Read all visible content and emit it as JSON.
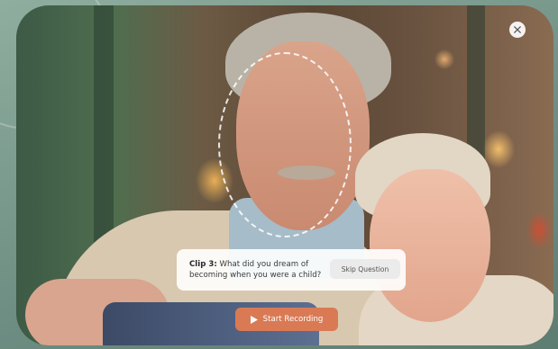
{
  "overlay": {
    "clip_label": "Clip 3:",
    "question": "What did you dream of becoming when you were a child?",
    "skip_label": "Skip Question",
    "record_label": "Start Recording"
  },
  "icons": {
    "close": "close-icon",
    "play": "play-icon"
  },
  "colors": {
    "accent": "#d97a55",
    "backdrop": "#7f9d92"
  }
}
